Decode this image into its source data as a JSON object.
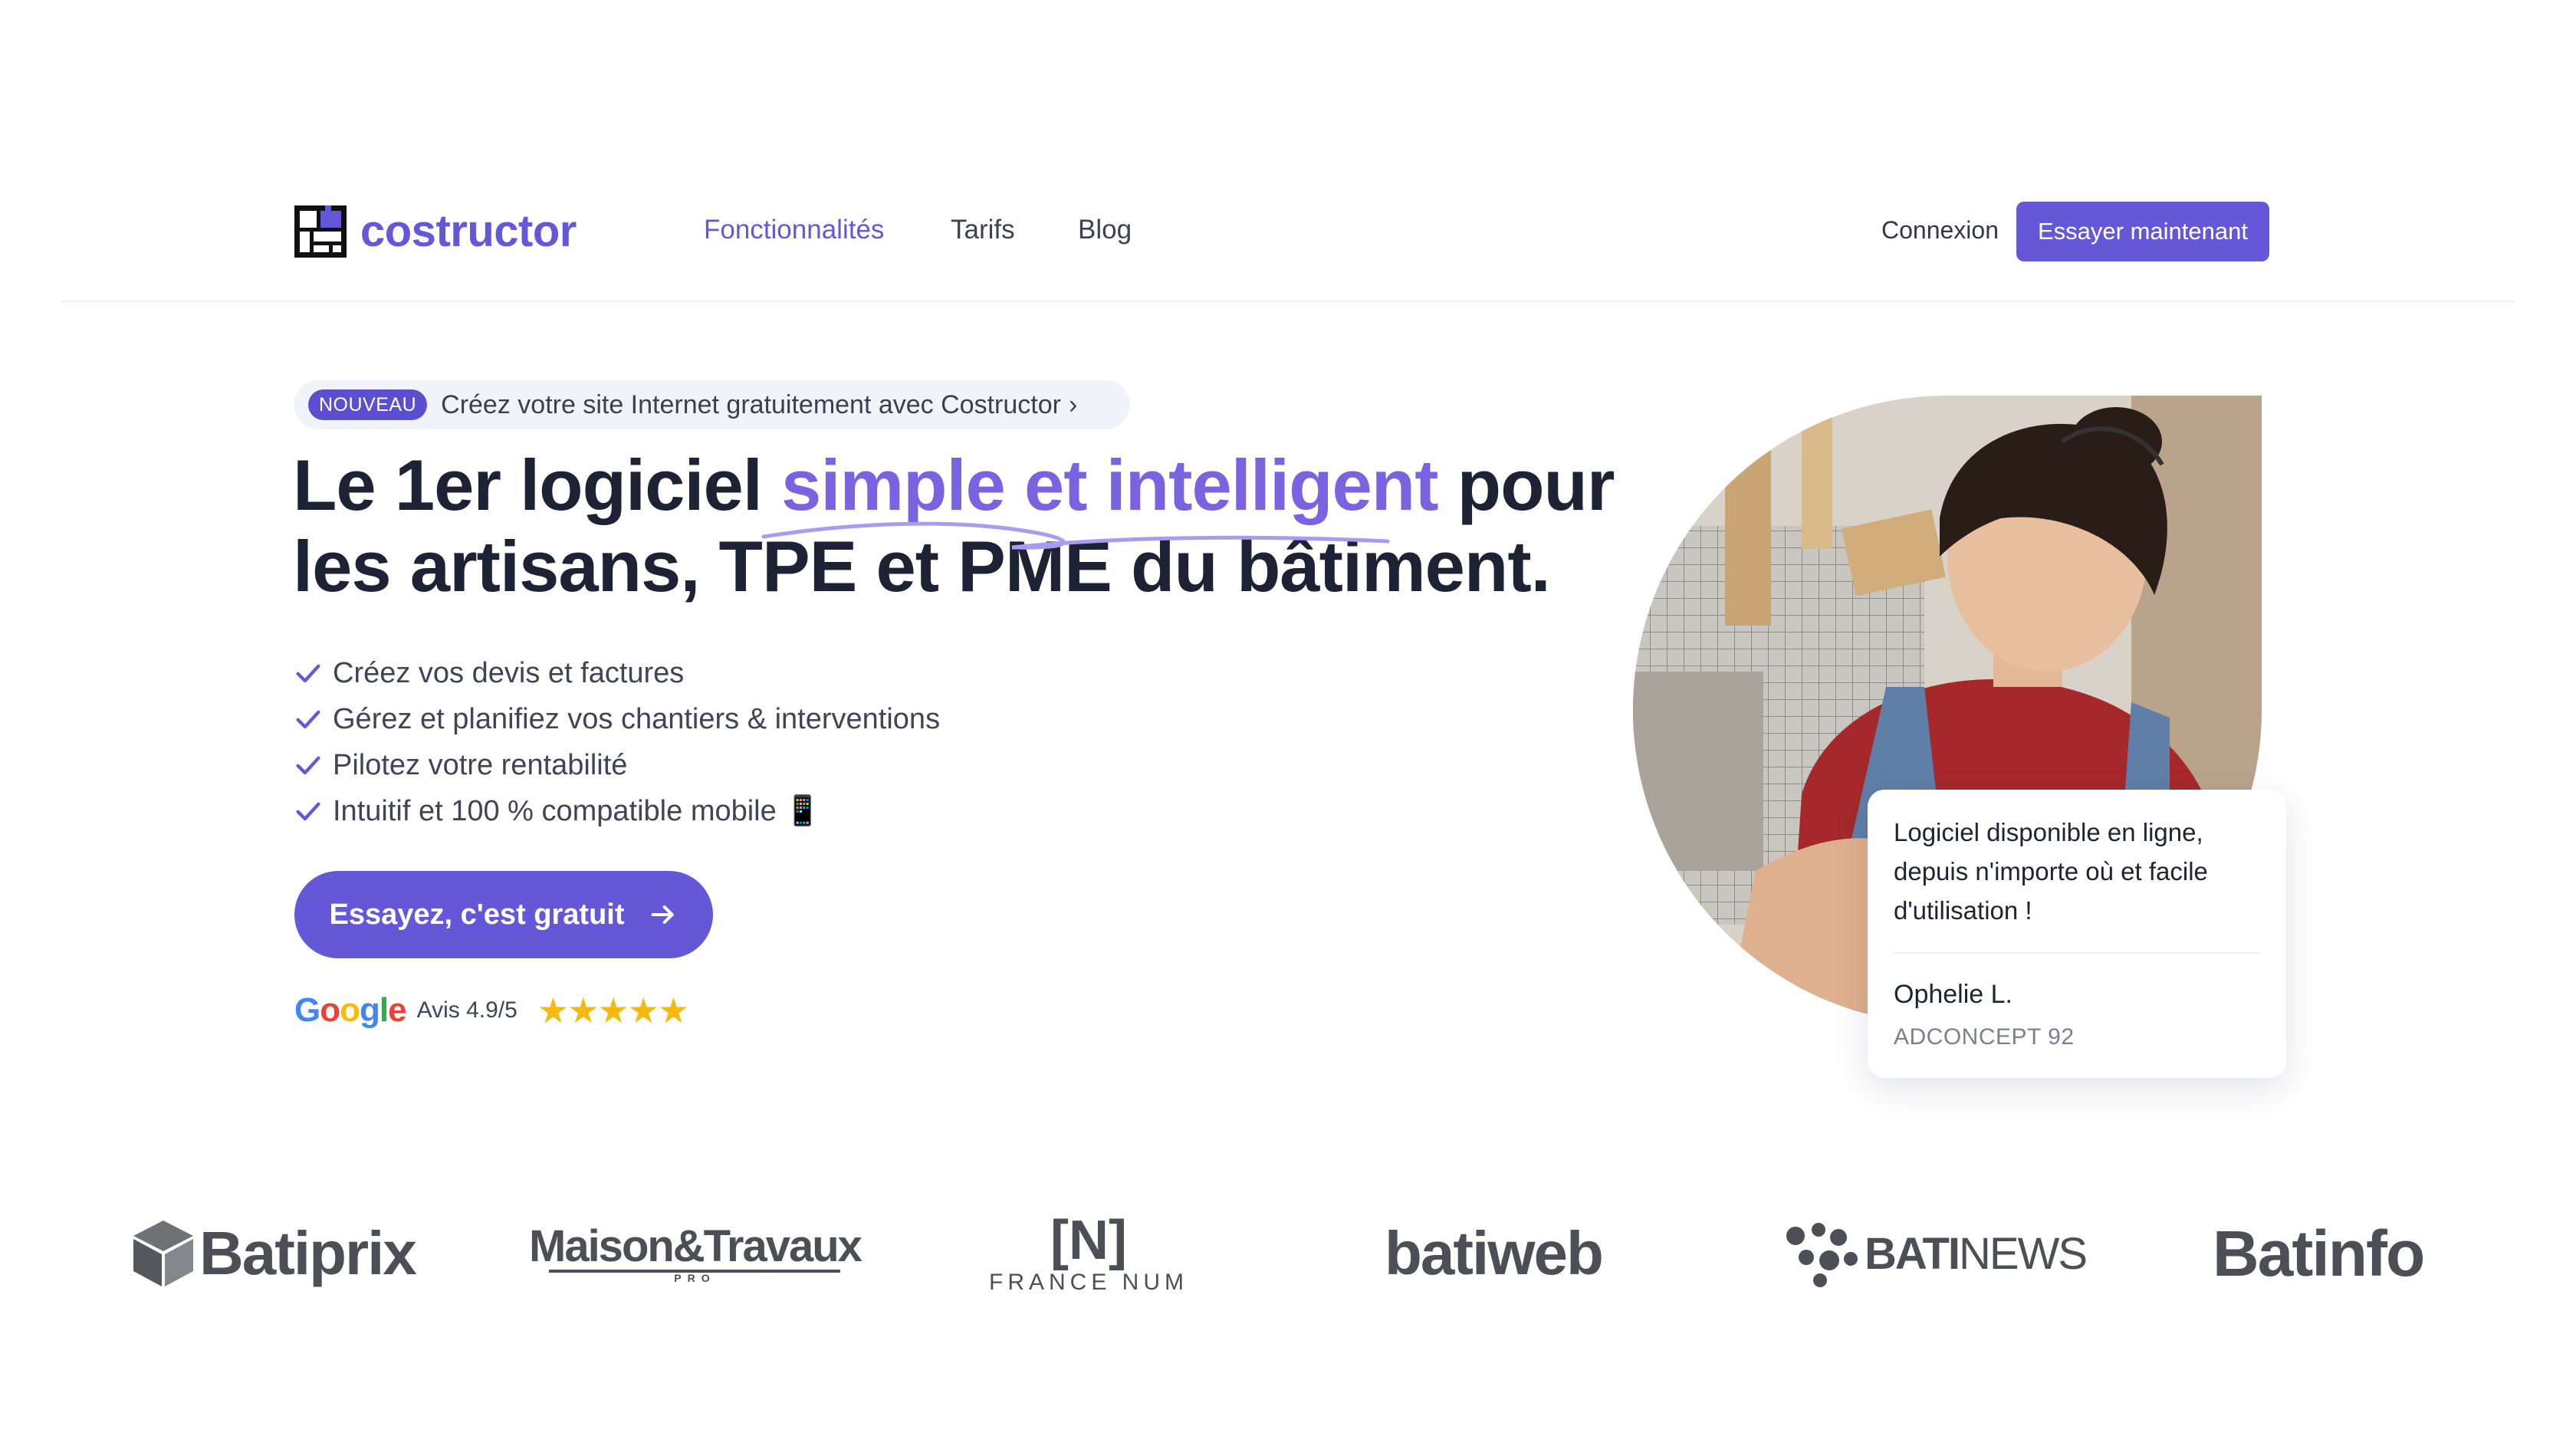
{
  "brand": {
    "name": "costructor",
    "accent": "#6457d8"
  },
  "nav": {
    "items": [
      {
        "label": "Fonctionnalités",
        "active": true
      },
      {
        "label": "Tarifs",
        "active": false
      },
      {
        "label": "Blog",
        "active": false
      }
    ],
    "login": "Connexion",
    "cta": "Essayer maintenant"
  },
  "announcement": {
    "badge": "NOUVEAU",
    "text": "Créez votre site Internet gratuitement avec Costructor",
    "icon": "chevron-right-icon"
  },
  "hero": {
    "title_before": "Le 1er logiciel ",
    "title_accent": "simple et intelligent",
    "title_after": " pour les artisans, TPE et PME du bâtiment.",
    "features": [
      "Créez vos devis et factures",
      "Gérez et planifiez vos chantiers & interventions",
      "Pilotez votre rentabilité",
      "Intuitif et 100 % compatible mobile 📱"
    ],
    "cta": "Essayez, c'est gratuit",
    "cta_icon": "arrow-right-icon"
  },
  "reviews": {
    "provider": "Google",
    "rating_text": "Avis 4.9/5",
    "stars": 5
  },
  "testimonial": {
    "text": "Logiciel disponible en ligne, depuis n'importe où et facile d'utilisation !",
    "name": "Ophelie L.",
    "company": "ADCONCEPT 92"
  },
  "partners": {
    "batiprix": "Batiprix",
    "maison": "Maison&Travaux",
    "maison_sub": "PRO",
    "francenum_mark": "[N]",
    "francenum_text": "FRANCE NUM",
    "batiweb": "batiweb",
    "batinews_bold": "BATI",
    "batinews_light": "NEWS",
    "batinfo": "Batinfo"
  }
}
